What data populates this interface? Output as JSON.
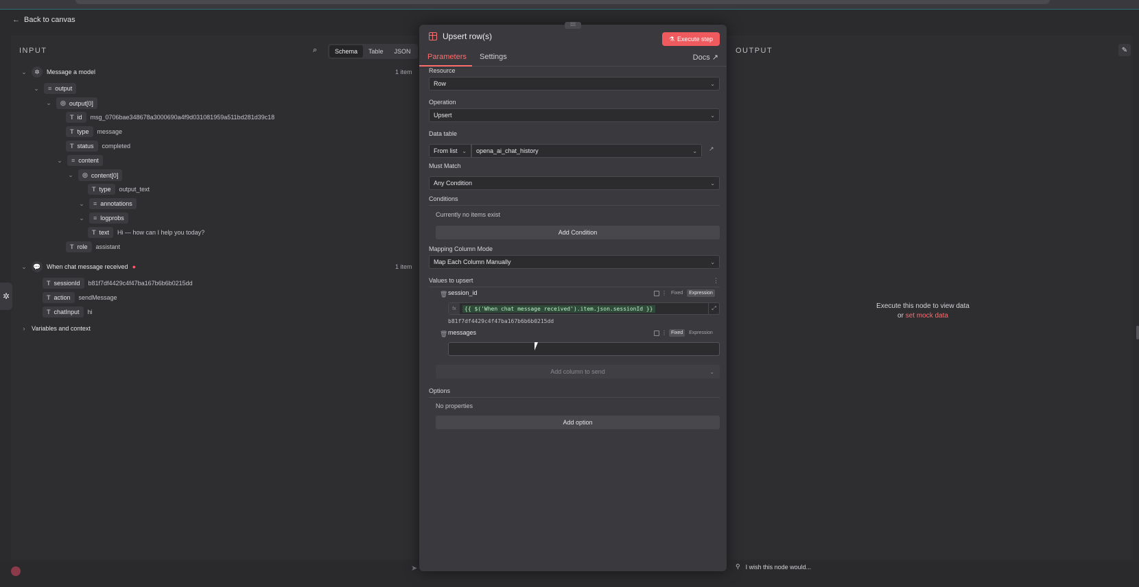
{
  "nav": {
    "back_label": "Back to canvas"
  },
  "input": {
    "title": "INPUT",
    "tabs": [
      "Schema",
      "Table",
      "JSON"
    ],
    "nodes": [
      {
        "name": "Message a model",
        "count": "1 item"
      },
      {
        "name": "When chat message received",
        "count": "1 item"
      }
    ],
    "tree": {
      "output": "output",
      "output0": "output[0]",
      "id_key": "id",
      "id_val": "msg_0706bae348678a3000690a4f9d031081959a511bd281d39c18",
      "type_key": "type",
      "type_val": "message",
      "status_key": "status",
      "status_val": "completed",
      "content": "content",
      "content0": "content[0]",
      "ctype_key": "type",
      "ctype_val": "output_text",
      "annotations": "annotations",
      "logprobs": "logprobs",
      "text_key": "text",
      "text_val": "Hi — how can I help you today?",
      "role_key": "role",
      "role_val": "assistant",
      "session_key": "sessionId",
      "session_val": "b81f7df4429c4f47ba167b6b6b0215dd",
      "action_key": "action",
      "action_val": "sendMessage",
      "chat_key": "chatInput",
      "chat_val": "hi"
    },
    "variables": "Variables and context"
  },
  "modal": {
    "title": "Upsert row(s)",
    "execute": "Execute step",
    "tabs": {
      "parameters": "Parameters",
      "settings": "Settings",
      "docs": "Docs"
    },
    "resource": {
      "label": "Resource",
      "value": "Row"
    },
    "operation": {
      "label": "Operation",
      "value": "Upsert"
    },
    "data_table": {
      "label": "Data table",
      "mode": "From list",
      "value": "opena_ai_chat_history"
    },
    "must_match": {
      "label": "Must Match",
      "value": "Any Condition"
    },
    "conditions": {
      "label": "Conditions",
      "empty": "Currently no items exist",
      "add": "Add Condition"
    },
    "mapping": {
      "label": "Mapping Column Mode",
      "value": "Map Each Column Manually"
    },
    "values": {
      "label": "Values to upsert",
      "fixed": "Fixed",
      "expression": "Expression",
      "session_name": "session_id",
      "session_expr": "{{ $('When chat message received').item.json.sessionId }}",
      "session_result": "b81f7df4429c4f47ba167b6b6b0215dd",
      "messages_name": "messages",
      "add_column": "Add column to send"
    },
    "options": {
      "label": "Options",
      "empty": "No properties",
      "add": "Add option"
    }
  },
  "output": {
    "title": "OUTPUT",
    "msg_line1": "Execute this node to view data",
    "msg_or": "or",
    "msg_link": "set mock data"
  },
  "footer": {
    "wish": "I wish this node would..."
  },
  "colors": {
    "accent": "#ff6d6d",
    "execute": "#ef5a5f",
    "bg": "#2b2a2c"
  }
}
